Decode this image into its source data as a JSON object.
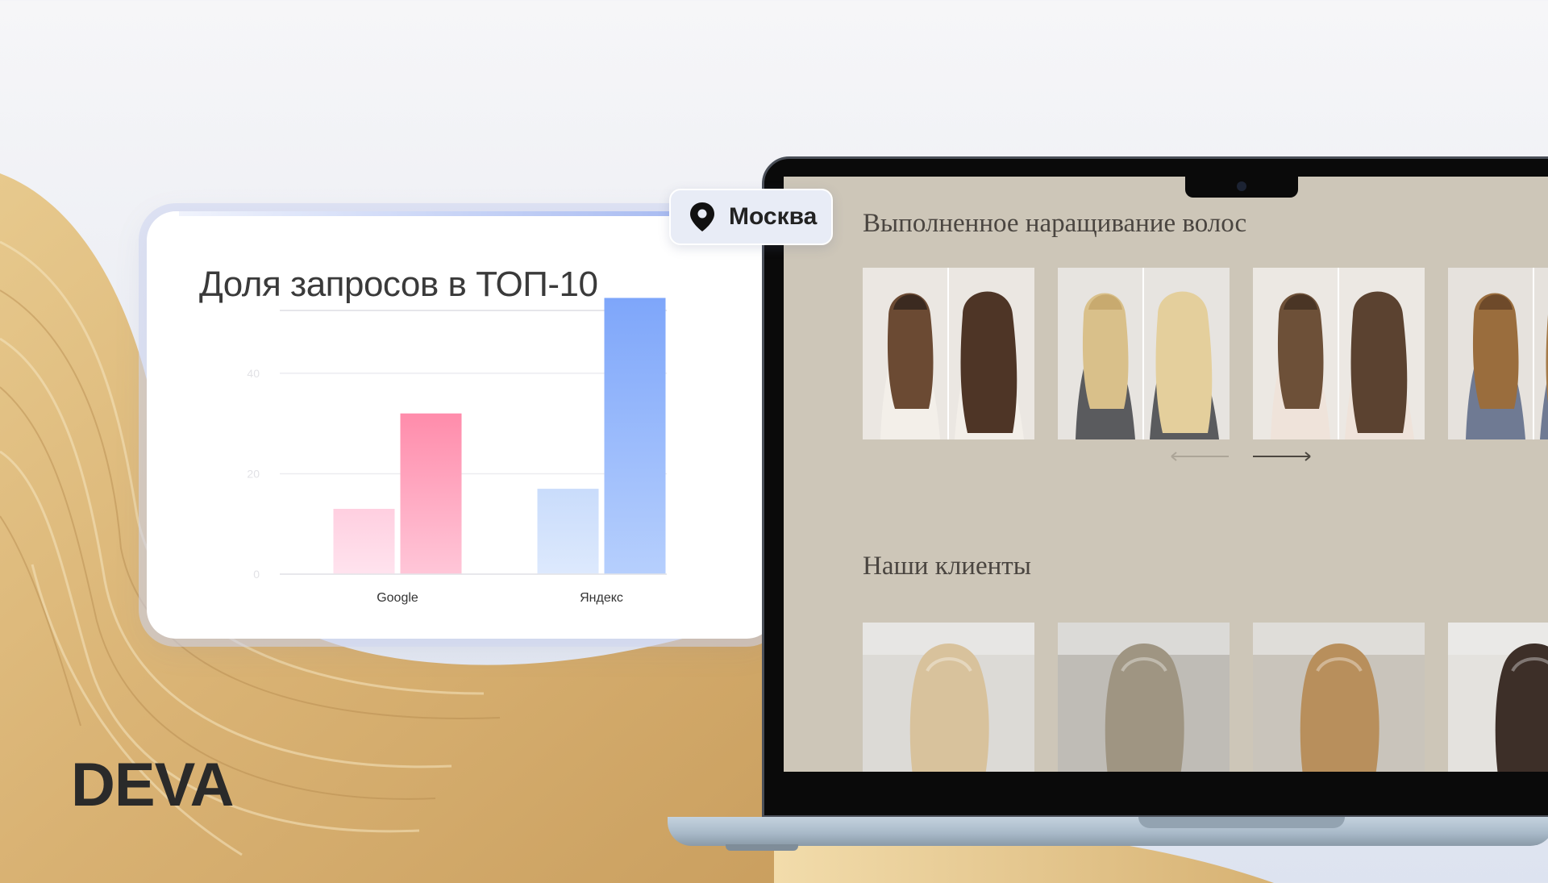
{
  "brand": {
    "name": "DEVA"
  },
  "location": {
    "city": "Москва",
    "icon": "map-pin-icon"
  },
  "chart_card": {
    "title": "Доля запросов в ТОП-10"
  },
  "chart_data": {
    "type": "bar",
    "title": "Доля запросов в ТОП-10",
    "categories": [
      "Google",
      "Яндекс"
    ],
    "series": [
      {
        "values": [
          13,
          17
        ],
        "colors": [
          "#ffd2e2",
          "#cfe0fb"
        ]
      },
      {
        "values": [
          32,
          55
        ],
        "colors": [
          "#ff8fae",
          "#80a8fa"
        ]
      }
    ],
    "yticks": [
      0,
      20,
      40
    ],
    "ylim": [
      0,
      57
    ],
    "grid": true
  },
  "site": {
    "works_title": "Выполненное наращивание волос",
    "clients_title": "Наши клиенты",
    "works_photos": [
      {
        "name": "before-after-brown",
        "left_hair": "#6b4a33",
        "right_hair": "#4e3526",
        "left_top": "#3b2a20",
        "bg": "#ebe7e2",
        "shirt": "#f3efe9"
      },
      {
        "name": "before-after-blonde",
        "left_hair": "#d9c08a",
        "right_hair": "#e4cf9c",
        "left_top": "#c8aa6f",
        "bg": "#e7e4e0",
        "shirt": "#5a5b5e"
      },
      {
        "name": "before-after-brunette",
        "left_hair": "#6d5038",
        "right_hair": "#5b4230",
        "left_top": "#4a3525",
        "bg": "#ece8e3",
        "shirt": "#efe3da"
      },
      {
        "name": "before-after-bob",
        "left_hair": "#9a6d3d",
        "right_hair": "#a57a48",
        "left_top": "#6e4a2a",
        "bg": "#e6e2dd",
        "shirt": "#6f7a93"
      }
    ],
    "clients_photos": [
      {
        "name": "client-light-blonde",
        "hair": "#d8c29c",
        "bg": "#dcdad6"
      },
      {
        "name": "client-ombre",
        "hair": "#9f9582",
        "bg": "#bfbcb6"
      },
      {
        "name": "client-honey-blonde",
        "hair": "#b88f5c",
        "bg": "#c9c4bb"
      },
      {
        "name": "client-dark-wavy",
        "hair": "#3d2f28",
        "bg": "#e4e2de"
      }
    ]
  }
}
